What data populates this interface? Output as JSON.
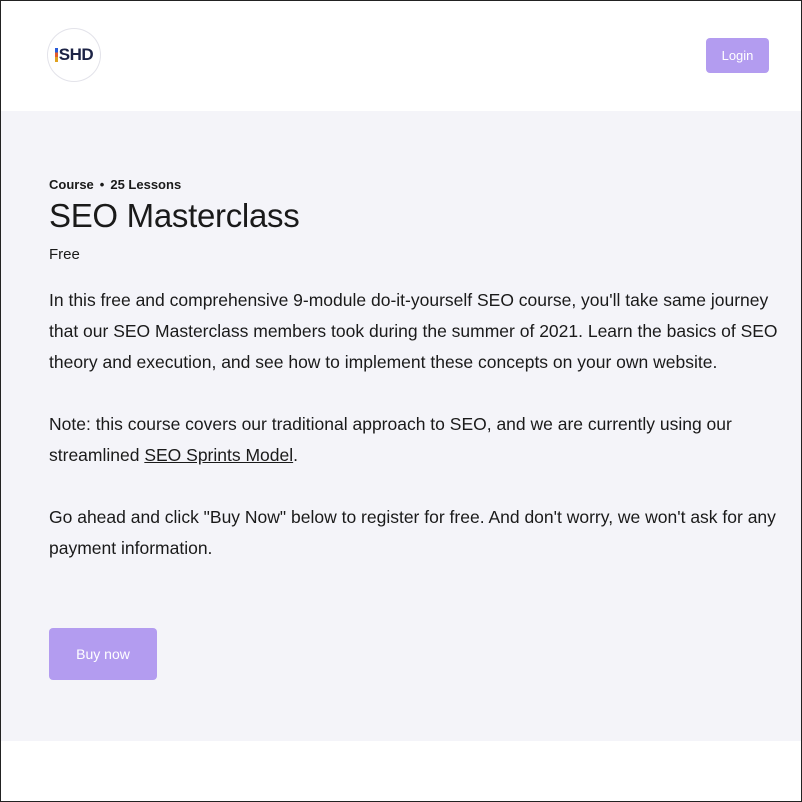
{
  "header": {
    "logo_text": "SHD",
    "login_label": "Login"
  },
  "course": {
    "type": "Course",
    "separator": "•",
    "lessons": "25 Lessons",
    "title": "SEO Masterclass",
    "price": "Free",
    "description": {
      "para1": "In this free and comprehensive 9-module do-it-yourself SEO course, you'll take same journey that our SEO Masterclass members took during the summer of 2021.  Learn the basics of SEO theory and execution, and see how to implement these concepts on your own website.",
      "para2_before": "Note: this course covers our traditional approach to SEO, and we are currently using our streamlined ",
      "para2_link": "SEO Sprints Model",
      "para2_after": ".",
      "para3": "Go ahead and click \"Buy Now\" below to register for free. And don't worry, we won't ask for any payment information."
    },
    "buy_label": "Buy now"
  },
  "colors": {
    "accent": "#b39cf0",
    "content_bg": "#f4f4f9",
    "text": "#1a1a1a"
  }
}
